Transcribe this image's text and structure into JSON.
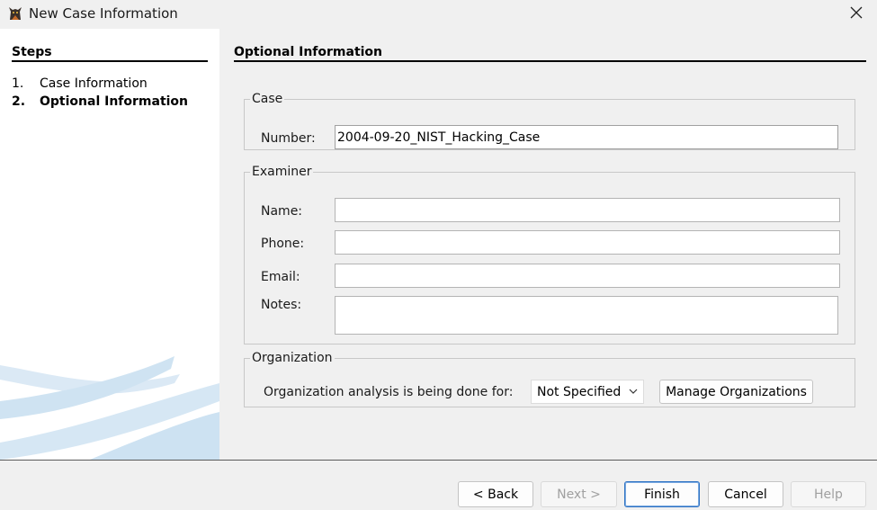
{
  "window": {
    "title": "New Case Information",
    "close_glyph": "✕"
  },
  "steps": {
    "title": "Steps",
    "items": [
      {
        "num": "1.",
        "label": "Case Information",
        "active": false
      },
      {
        "num": "2.",
        "label": "Optional Information",
        "active": true
      }
    ]
  },
  "content": {
    "title": "Optional Information",
    "case": {
      "legend": "Case",
      "number_label": "Number:",
      "number_value": "2004-09-20_NIST_Hacking_Case"
    },
    "examiner": {
      "legend": "Examiner",
      "name_label": "Name:",
      "name_value": "",
      "phone_label": "Phone:",
      "phone_value": "",
      "email_label": "Email:",
      "email_value": "",
      "notes_label": "Notes:",
      "notes_value": ""
    },
    "organization": {
      "legend": "Organization",
      "label": "Organization analysis is being done for:",
      "selected": "Not Specified",
      "manage_label": "Manage Organizations"
    }
  },
  "footer": {
    "back_label": "< Back",
    "next_label": "Next >",
    "finish_label": "Finish",
    "cancel_label": "Cancel",
    "help_label": "Help"
  },
  "colors": {
    "default_button_border": "#2f73c4",
    "swoosh": "#cfe3f2"
  }
}
